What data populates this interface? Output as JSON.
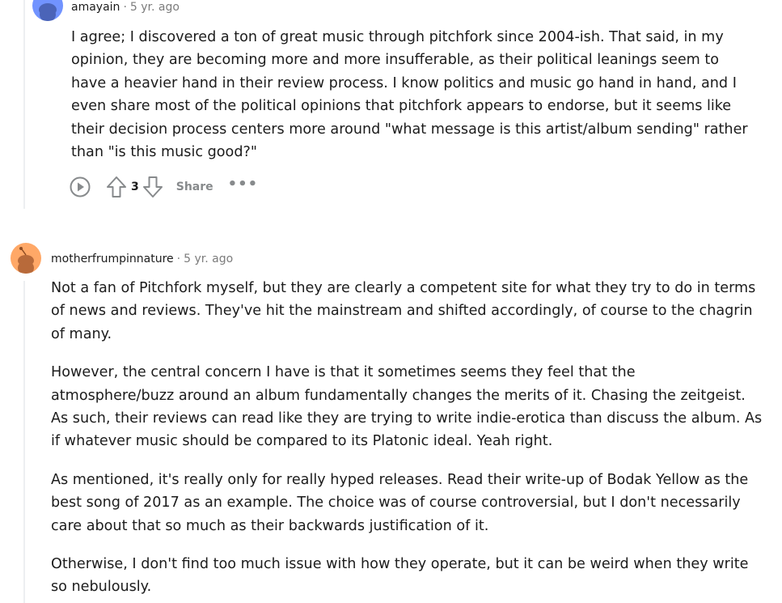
{
  "comments": [
    {
      "author": "amayain",
      "separator": "·",
      "time": "5 yr. ago",
      "avatar_color": "#7193ff",
      "paragraphs": [
        "I agree; I discovered a ton of great music through pitchfork since 2004-ish. That said, in my opinion, they are becoming more and more insufferable, as their political leanings seem to have a heavier hand in their review process. I know politics and music go hand in hand, and I even share most of the political opinions that pitchfork appears to endorse, but it seems like their decision process centers more around \"what message is this artist/album sending\" rather than \"is this music good?\""
      ],
      "actions": {
        "play_icon": "play-circle-icon",
        "upvote_icon": "upvote-arrow-icon",
        "vote_count": "3",
        "downvote_icon": "downvote-arrow-icon",
        "share_label": "Share",
        "more_label": "•••"
      }
    },
    {
      "author": "motherfrumpinnature",
      "separator": "·",
      "time": "5 yr. ago",
      "avatar_color": "#ffa867",
      "paragraphs": [
        "Not a fan of Pitchfork myself, but they are clearly a competent site for what they try to do in terms of news and reviews. They've hit the mainstream and shifted accordingly, of course to the chagrin of many.",
        "However, the central concern I have is that it sometimes seems they feel that the atmosphere/buzz around an album fundamentally changes the merits of it. Chasing the zeitgeist. As such, their reviews can read like they are trying to write indie-erotica than discuss the album. As if whatever music should be compared to its Platonic ideal. Yeah right.",
        "As mentioned, it's really only for really hyped releases. Read their write-up of Bodak Yellow as the best song of 2017 as an example. The choice was of course controversial, but I don't necessarily care about that so much as their backwards justification of it.",
        "Otherwise, I don't find too much issue with how they operate, but it can be weird when they write so nebulously."
      ]
    }
  ]
}
